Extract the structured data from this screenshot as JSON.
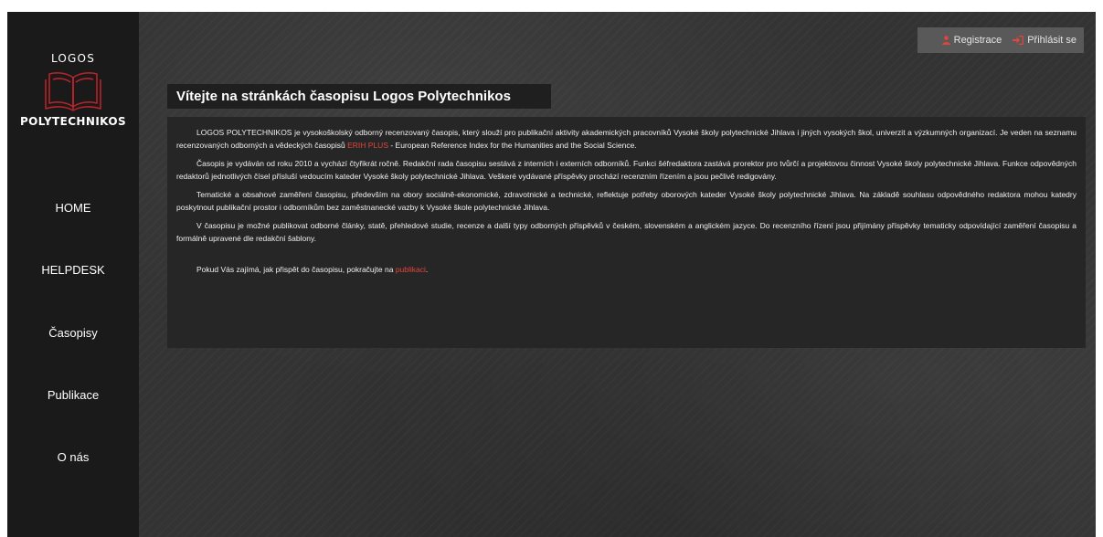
{
  "logo": {
    "top_text": "LOGOS",
    "bottom_text": "POLYTECHNIKOS",
    "book_color": "#b8232c"
  },
  "nav": [
    {
      "label": "HOME"
    },
    {
      "label": "HELPDESK"
    },
    {
      "label": "Časopisy"
    },
    {
      "label": "Publikace"
    },
    {
      "label": "O nás"
    }
  ],
  "auth": {
    "register_label": "Registrace",
    "register_icon": "user-icon",
    "login_label": "Přihlásit se",
    "login_icon": "sign-in-icon",
    "icon_color": "#e0463c"
  },
  "page": {
    "title": "Vítejte na stránkách časopisu Logos Polytechnikos"
  },
  "content": {
    "p1_before": "LOGOS POLYTECHNIKOS je vysokoškolský odborný recenzovaný časopis, který slouží pro publikační aktivity akademických pracovníků Vysoké školy polytechnické Jihlava i jiných vysokých škol, univerzit a výzkumných organizací. Je veden na seznamu recenzovaných odborných a vědeckých časopisů ",
    "p1_link": "ERIH PLUS",
    "p1_after": " - European Reference Index for the Humanities and the Social Science.",
    "p2": "Časopis je vydáván od roku 2010 a vychází čtyřikrát ročně. Redakční rada časopisu sestává z interních i externích odborníků. Funkci šéfredaktora zastává prorektor pro tvůrčí a projektovou činnost Vysoké školy polytechnické Jihlava. Funkce odpovědných redaktorů jednotlivých čísel přísluší vedoucím kateder Vysoké školy polytechnické Jihlava. Veškeré vydávané příspěvky prochází recenzním řízením a jsou pečlivě redigovány.",
    "p3": "Tematické a obsahové zaměření časopisu, především na obory sociálně-ekonomické, zdravotnické a technické, reflektuje potřeby oborových kateder Vysoké školy polytechnické Jihlava. Na základě souhlasu odpovědného redaktora mohou katedry poskytnout publikační prostor i odborníkům bez zaměstnanecké vazby k Vysoké škole polytechnické Jihlava.",
    "p4": "V časopisu je možné publikovat odborné články, statě, přehledové studie, recenze a další typy odborných příspěvků v českém, slovenském a anglickém jazyce. Do recenzního řízení jsou přijímány příspěvky tematicky odpovídající zaměření časopisu a formálně upravené dle redakční šablony.",
    "p5_before": "Pokud Vás zajímá, jak přispět do časopisu, pokračujte na ",
    "p5_link": "publikaci",
    "p5_after": "."
  },
  "colors": {
    "sidebar_bg": "#1a1a1a",
    "link_red": "#e0463c"
  }
}
